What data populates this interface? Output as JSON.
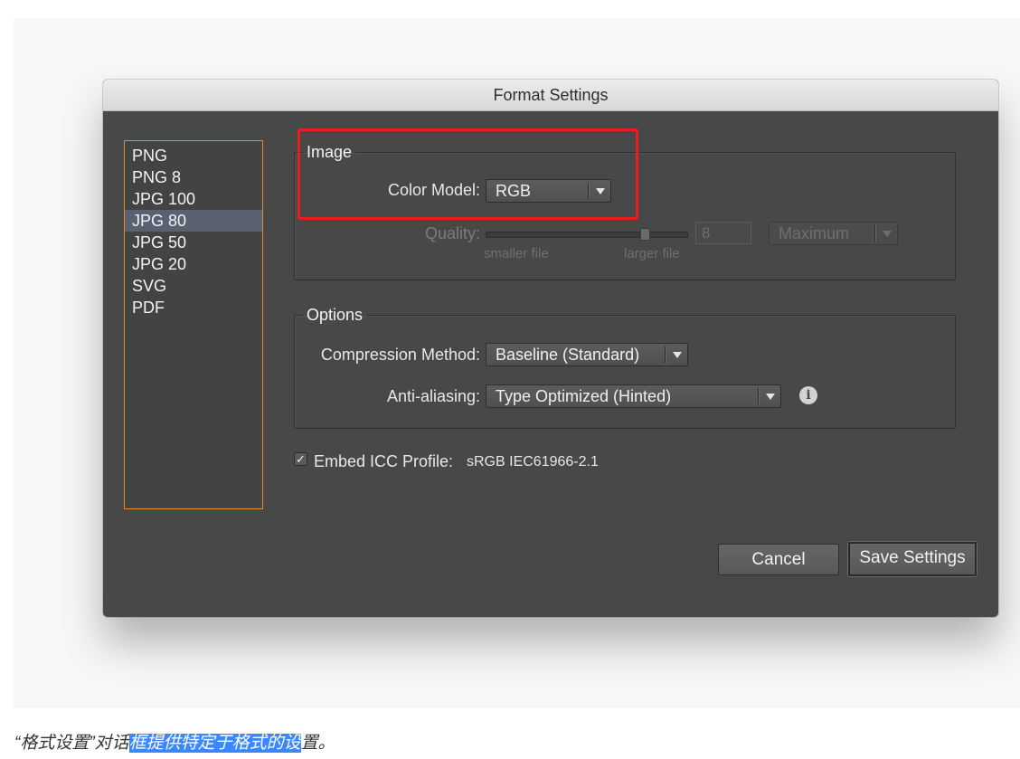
{
  "dialog": {
    "title": "Format Settings",
    "presets": [
      "PNG",
      "PNG 8",
      "JPG 100",
      "JPG 80",
      "JPG 50",
      "JPG 20",
      "SVG",
      "PDF"
    ],
    "selected_preset": "JPG 80"
  },
  "image_group": {
    "legend": "Image",
    "color_model_label": "Color Model:",
    "color_model_value": "RGB",
    "quality_label": "Quality:",
    "quality_value": "8",
    "quality_level": 0.8,
    "smaller_file": "smaller file",
    "larger_file": "larger file",
    "quality_preset": "Maximum"
  },
  "options_group": {
    "legend": "Options",
    "compression_label": "Compression Method:",
    "compression_value": "Baseline (Standard)",
    "antialias_label": "Anti-aliasing:",
    "antialias_value": "Type Optimized (Hinted)"
  },
  "icc": {
    "checked": true,
    "label": "Embed ICC Profile:",
    "profile": "sRGB IEC61966-2.1"
  },
  "buttons": {
    "cancel": "Cancel",
    "save": "Save Settings"
  },
  "caption": {
    "part1": "“格式设置”对话",
    "part2_selected": "框提供特定于格式的设",
    "part3": "置。"
  },
  "colors": {
    "highlight_box": "#ee1d1d",
    "list_border": "#e18f2a",
    "selected_row": "#5a6170",
    "text_selection": "#3a88fe"
  }
}
